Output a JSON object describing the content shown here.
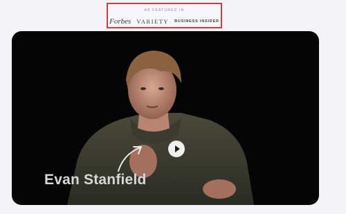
{
  "featured": {
    "caption": "AS FEATURED IN",
    "logos": [
      "Forbes",
      "VARIETY",
      "BUSINESS INSIDER"
    ],
    "highlight_color": "#d7373f"
  },
  "video": {
    "overlay_name": "Evan Stanfield",
    "play_icon": "play-icon",
    "background": "#050505"
  }
}
